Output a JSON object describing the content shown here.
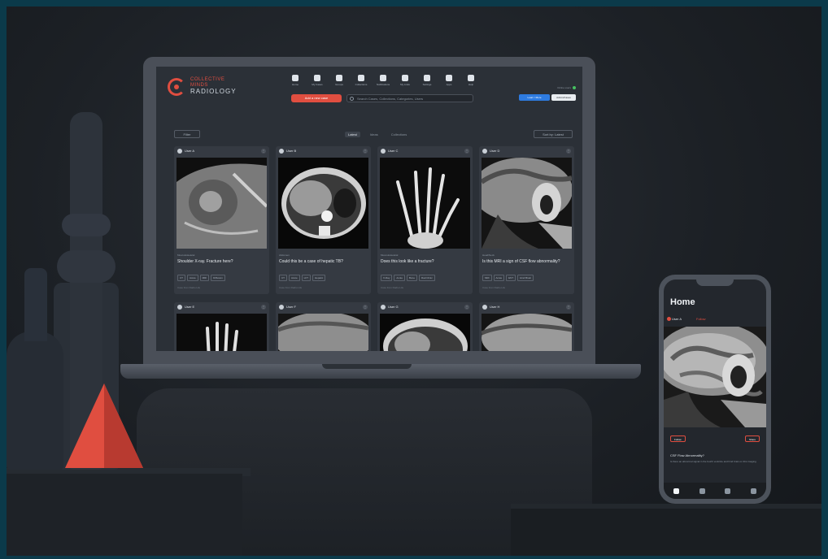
{
  "app": {
    "logo_line1": "COLLECTIVE",
    "logo_line2": "MINDS",
    "logo_line3": "RADIOLOGY",
    "new_case_label": "Add a new case",
    "search_placeholder": "Search Cases, Collections, Categories, Users",
    "status_text": "Online users",
    "role_primary": "Learn / More",
    "role_secondary": "Admin/Cases"
  },
  "nav": [
    {
      "label": "Home",
      "icon": "home-icon"
    },
    {
      "label": "My Cases",
      "icon": "folder-icon"
    },
    {
      "label": "Groups",
      "icon": "group-icon"
    },
    {
      "label": "Collections",
      "icon": "collection-icon"
    },
    {
      "label": "Notifications",
      "icon": "bell-icon"
    },
    {
      "label": "My Links",
      "icon": "link-icon"
    },
    {
      "label": "Settings",
      "icon": "gear-icon"
    },
    {
      "label": "Apps",
      "icon": "grid-icon"
    },
    {
      "label": "Help",
      "icon": "help-icon"
    }
  ],
  "filter_label": "Filter",
  "view_tabs": [
    "Latest",
    "Ideas",
    "Collections"
  ],
  "sort_label": "Sort by: Latest",
  "cards": [
    {
      "user": "User A",
      "meta": "Musculoskeletal",
      "title": "Shoulder X-ray. Fracture here?",
      "tags": [
        "CT",
        "Acute",
        "MRI",
        "Diffusion"
      ],
      "foot": "Case from Radio Life"
    },
    {
      "user": "User B",
      "meta": "Abdomen",
      "title": "Could this be a case of hepatic TB?",
      "tags": [
        "CT",
        "Acute",
        "LFT",
        "Hepatic"
      ],
      "foot": "Case from Radio Life"
    },
    {
      "user": "User C",
      "meta": "Musculoskeletal",
      "title": "Does this look like a fracture?",
      "tags": [
        "X-Ray",
        "Acute",
        "Bone",
        "Rad Clinic"
      ],
      "foot": "Case from Radio Life"
    },
    {
      "user": "User D",
      "meta": "Head/Neck",
      "title": "Is this MRI a sign of CSF flow abnormality?",
      "tags": [
        "MRI",
        "Acute",
        "ENT",
        "Hind Brain"
      ],
      "foot": "Case from Radio Life"
    },
    {
      "user": "User E"
    },
    {
      "user": "User F"
    },
    {
      "user": "User G"
    },
    {
      "user": "User H"
    }
  ],
  "phone": {
    "title": "Home",
    "user": "User A",
    "follow": "Follow",
    "btn_left": "Follow",
    "btn_right": "Share",
    "caption": "CSF Flow Abnormality?",
    "desc": "Is there an abnormal signal in the fourth ventricle and hind brain on this imaging"
  }
}
